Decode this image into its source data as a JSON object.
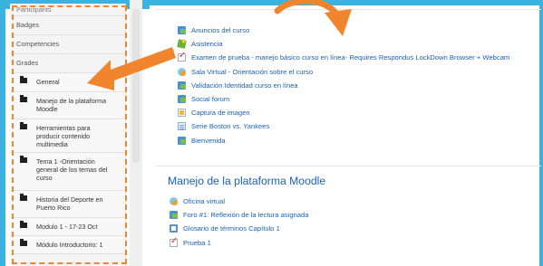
{
  "sidebar": {
    "items": [
      {
        "label": "Participants"
      },
      {
        "label": "Badges"
      },
      {
        "label": "Competencies"
      },
      {
        "label": "Grades"
      }
    ],
    "sections": [
      {
        "label": "General"
      },
      {
        "label": "Manejo de la plataforma Moodle"
      },
      {
        "label": "Herramientas para producir contenido multimedia"
      },
      {
        "label": "Tema 1 -Orientación general de los temas del curso"
      },
      {
        "label": "Historia del Deporte en Puerto Rico"
      },
      {
        "label": "Modulo 1 - 17-23 Oct"
      },
      {
        "label": "Módulo Introductorio: 1"
      }
    ]
  },
  "general_activities": [
    {
      "icon": "forum-icon",
      "label": "Anuncios del curso"
    },
    {
      "icon": "attendance-icon",
      "label": "Asistencia"
    },
    {
      "icon": "quiz-icon",
      "label": "Examen de prueba - manejo básico curso en línea- Requires Respondus LockDown Browser + Webcam"
    },
    {
      "icon": "chat-icon",
      "label": "Sala Virtual - Orientación sobre el curso"
    },
    {
      "icon": "forum-icon",
      "label": "Validación Identidad curso en línea"
    },
    {
      "icon": "forum-icon",
      "label": "Social forum"
    },
    {
      "icon": "assignment-icon",
      "label": "Captura de imagen"
    },
    {
      "icon": "page-icon",
      "label": "Serie Boston vs. Yankees"
    },
    {
      "icon": "forum-icon",
      "label": "Bienvenida"
    }
  ],
  "section2": {
    "title": "Manejo de la plataforma Moodle",
    "activities": [
      {
        "icon": "chat-icon",
        "label": "Oficina virtual"
      },
      {
        "icon": "forum-icon",
        "label": "Foro #1: Reflexión de la lectura asignada"
      },
      {
        "icon": "glossary-icon",
        "label": "Glosario de términos Capítulo 1"
      },
      {
        "icon": "quiz-icon",
        "label": "Prueba 1"
      }
    ]
  },
  "colors": {
    "link": "#1a61b8",
    "accent_arrow": "#f0852d",
    "frame": "#3bb3e0"
  }
}
